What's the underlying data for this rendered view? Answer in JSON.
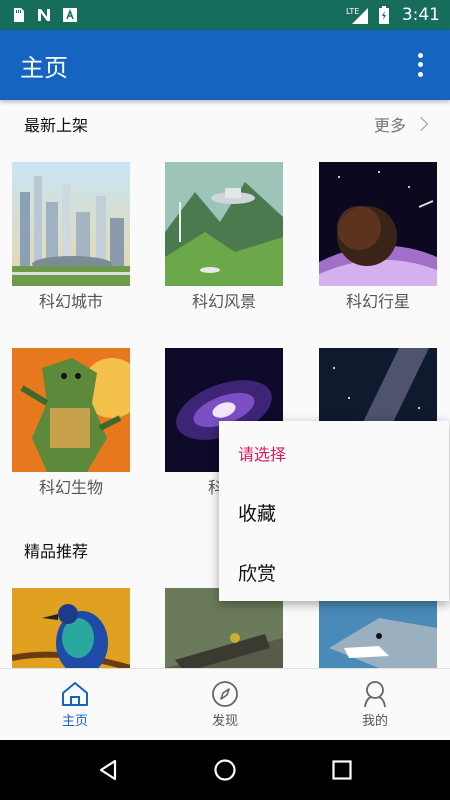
{
  "status_bar": {
    "time": "3:41",
    "network": "LTE",
    "icons": [
      "sd-card-icon",
      "n-notification-icon",
      "a-notification-icon",
      "signal-icon",
      "battery-icon"
    ]
  },
  "app_bar": {
    "title": "主页",
    "menu_icon": "more-vert-icon"
  },
  "sections": {
    "new": {
      "title": "最新上架",
      "more_label": "更多",
      "items": [
        {
          "caption": "科幻城市"
        },
        {
          "caption": "科幻风景"
        },
        {
          "caption": "科幻行星"
        },
        {
          "caption": "科幻生物"
        },
        {
          "caption": "科幻"
        }
      ]
    },
    "featured": {
      "title": "精品推荐"
    }
  },
  "popup": {
    "title": "请选择",
    "options": [
      "收藏",
      "欣赏"
    ]
  },
  "bottom_nav": {
    "items": [
      {
        "label": "主页",
        "icon": "home-icon",
        "active": true
      },
      {
        "label": "发现",
        "icon": "compass-icon",
        "active": false
      },
      {
        "label": "我的",
        "icon": "profile-icon",
        "active": false
      }
    ]
  },
  "colors": {
    "status_bar": "#176d5b",
    "app_bar": "#1565c0",
    "accent": "#d81b60",
    "active_nav": "#1565c0"
  }
}
